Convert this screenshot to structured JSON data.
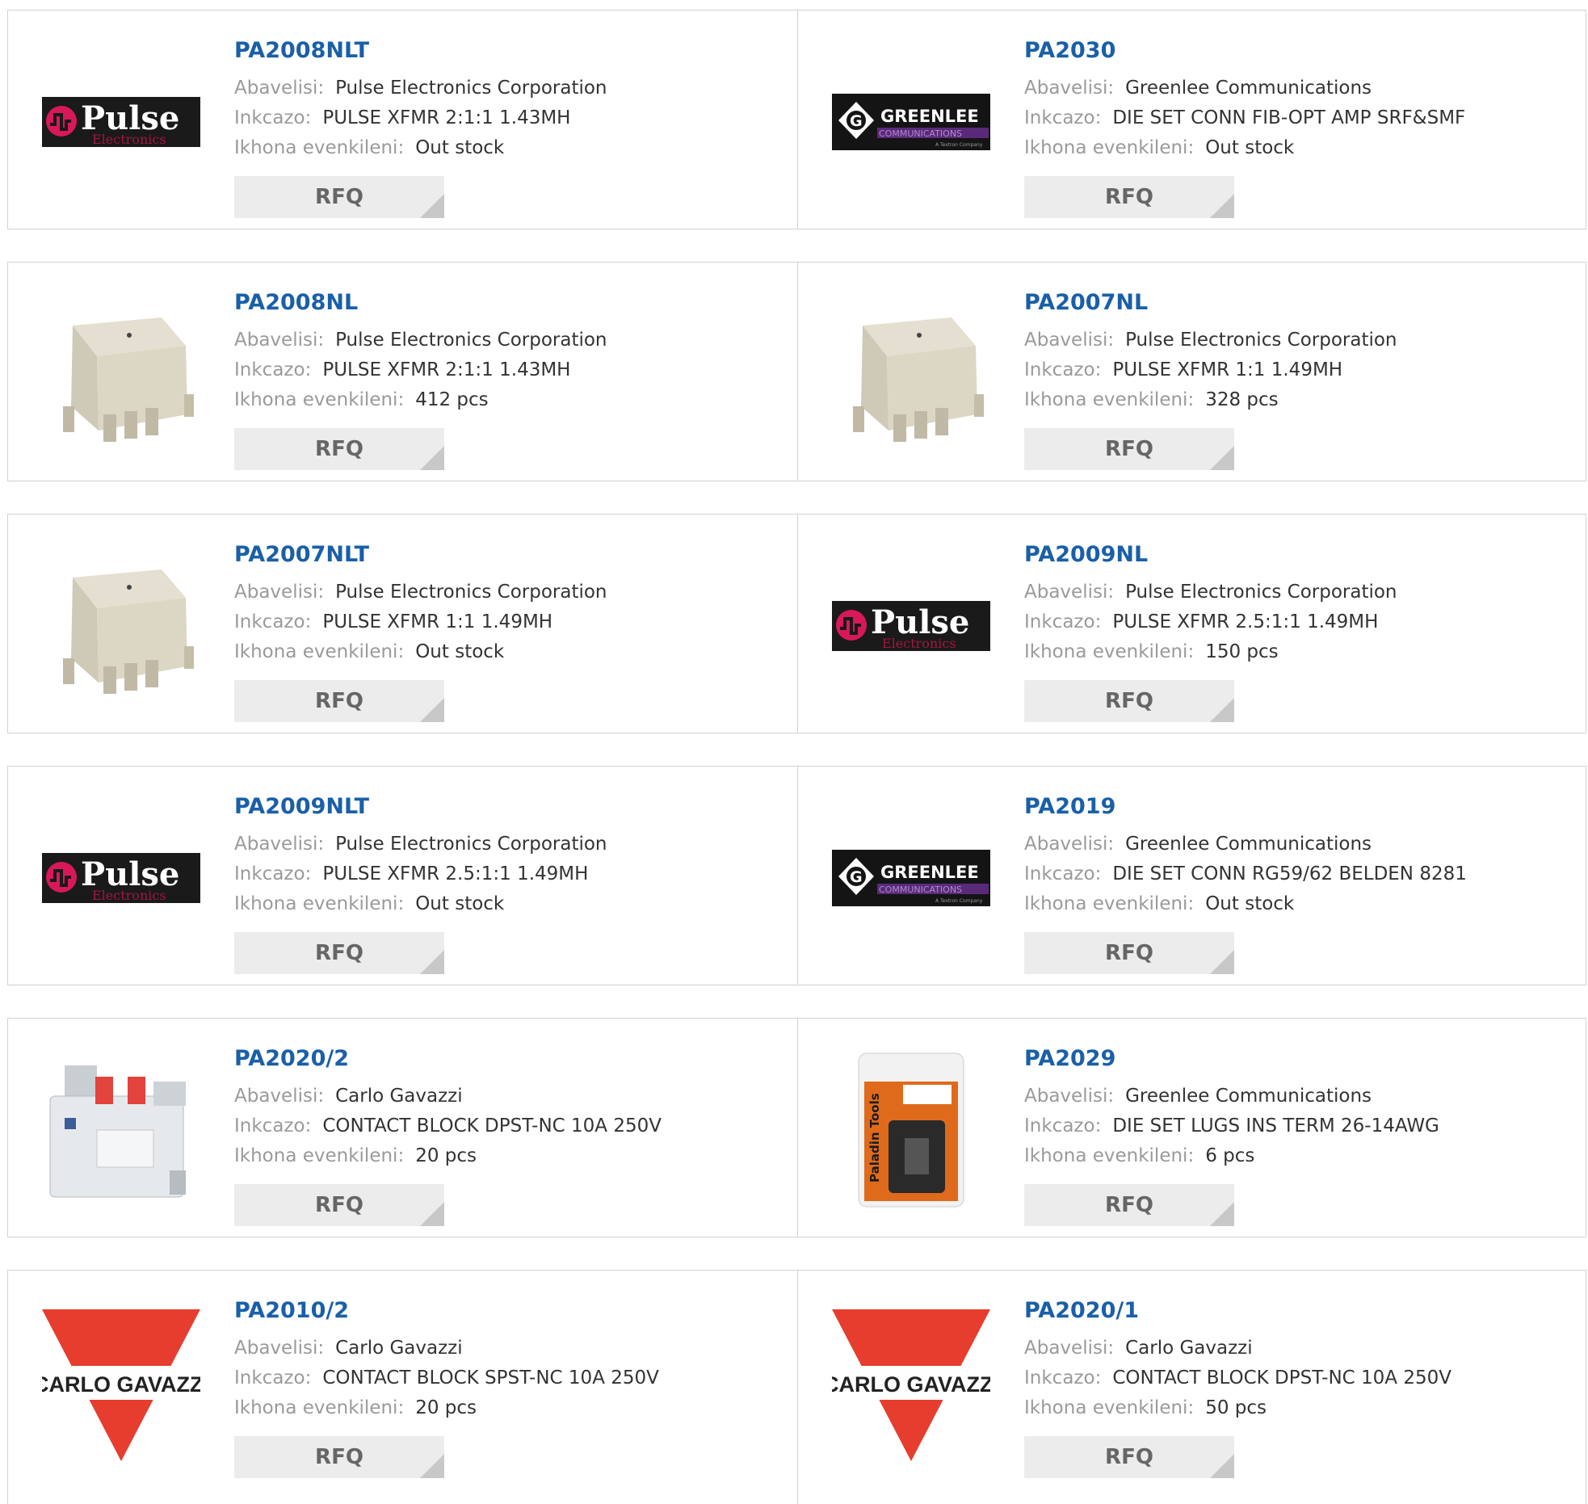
{
  "labels": {
    "manufacturer": "Abavelisi:",
    "description": "Inkcazo:",
    "stock": "Ikhona evenkileni:",
    "rfq": "RFQ"
  },
  "logos": {
    "pulse": {
      "word": "Pulse",
      "sub": "Electronics"
    },
    "greenlee": {
      "word": "GREENLEE",
      "sub": "COMMUNICATIONS",
      "tag": "A Textron Company"
    },
    "carlo": {
      "word": "CARLO GAVAZZI"
    },
    "paladin": {
      "word": "Paladin Tools"
    }
  },
  "colors": {
    "part_link": "#1a5fa8",
    "rfq_bg": "#ececec",
    "border": "#d2d2d2"
  },
  "products": [
    {
      "part": "PA2008NLT",
      "manufacturer": "Pulse Electronics Corporation",
      "description": "PULSE XFMR 2:1:1 1.43MH",
      "stock": "Out stock",
      "image": "pulse-logo"
    },
    {
      "part": "PA2030",
      "manufacturer": "Greenlee Communications",
      "description": "DIE SET CONN FIB-OPT AMP SRF&SMF",
      "stock": "Out stock",
      "image": "greenlee-logo"
    },
    {
      "part": "PA2008NL",
      "manufacturer": "Pulse Electronics Corporation",
      "description": "PULSE XFMR 2:1:1 1.43MH",
      "stock": "412 pcs",
      "image": "transformer-photo"
    },
    {
      "part": "PA2007NL",
      "manufacturer": "Pulse Electronics Corporation",
      "description": "PULSE XFMR 1:1 1.49MH",
      "stock": "328 pcs",
      "image": "transformer-photo"
    },
    {
      "part": "PA2007NLT",
      "manufacturer": "Pulse Electronics Corporation",
      "description": "PULSE XFMR 1:1 1.49MH",
      "stock": "Out stock",
      "image": "transformer-photo"
    },
    {
      "part": "PA2009NL",
      "manufacturer": "Pulse Electronics Corporation",
      "description": "PULSE XFMR 2.5:1:1 1.49MH",
      "stock": "150 pcs",
      "image": "pulse-logo"
    },
    {
      "part": "PA2009NLT",
      "manufacturer": "Pulse Electronics Corporation",
      "description": "PULSE XFMR 2.5:1:1 1.49MH",
      "stock": "Out stock",
      "image": "pulse-logo"
    },
    {
      "part": "PA2019",
      "manufacturer": "Greenlee Communications",
      "description": "DIE SET CONN RG59/62 BELDEN 8281",
      "stock": "Out stock",
      "image": "greenlee-logo"
    },
    {
      "part": "PA2020/2",
      "manufacturer": "Carlo Gavazzi",
      "description": "CONTACT BLOCK DPST-NC 10A 250V",
      "stock": "20 pcs",
      "image": "contact-block-photo"
    },
    {
      "part": "PA2029",
      "manufacturer": "Greenlee Communications",
      "description": "DIE SET LUGS INS TERM 26-14AWG",
      "stock": "6 pcs",
      "image": "paladin-package-photo"
    },
    {
      "part": "PA2010/2",
      "manufacturer": "Carlo Gavazzi",
      "description": "CONTACT BLOCK SPST-NC 10A 250V",
      "stock": "20 pcs",
      "image": "carlo-gavazzi-logo"
    },
    {
      "part": "PA2020/1",
      "manufacturer": "Carlo Gavazzi",
      "description": "CONTACT BLOCK DPST-NC 10A 250V",
      "stock": "50 pcs",
      "image": "carlo-gavazzi-logo"
    }
  ]
}
